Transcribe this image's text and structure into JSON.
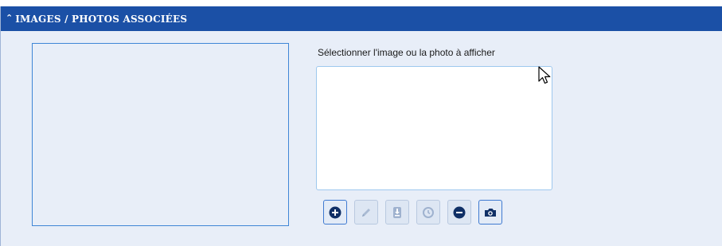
{
  "panel": {
    "title": "IMAGES / PHOTOS ASSOCIÉES",
    "collapse_icon": "double-chevron-up-icon",
    "header_color": "#1b50a6",
    "background_color": "#e8eef8"
  },
  "image_selector": {
    "label": "Sélectionner l'image ou la photo à afficher",
    "items": []
  },
  "toolbar": {
    "buttons": [
      {
        "name": "add-button",
        "icon": "plus-circle-icon",
        "enabled": true
      },
      {
        "name": "edit-button",
        "icon": "pencil-icon",
        "enabled": false
      },
      {
        "name": "import-button",
        "icon": "download-icon",
        "enabled": false
      },
      {
        "name": "history-button",
        "icon": "clock-icon",
        "enabled": false
      },
      {
        "name": "remove-button",
        "icon": "minus-circle-icon",
        "enabled": true
      },
      {
        "name": "camera-button",
        "icon": "camera-icon",
        "enabled": true
      }
    ]
  }
}
